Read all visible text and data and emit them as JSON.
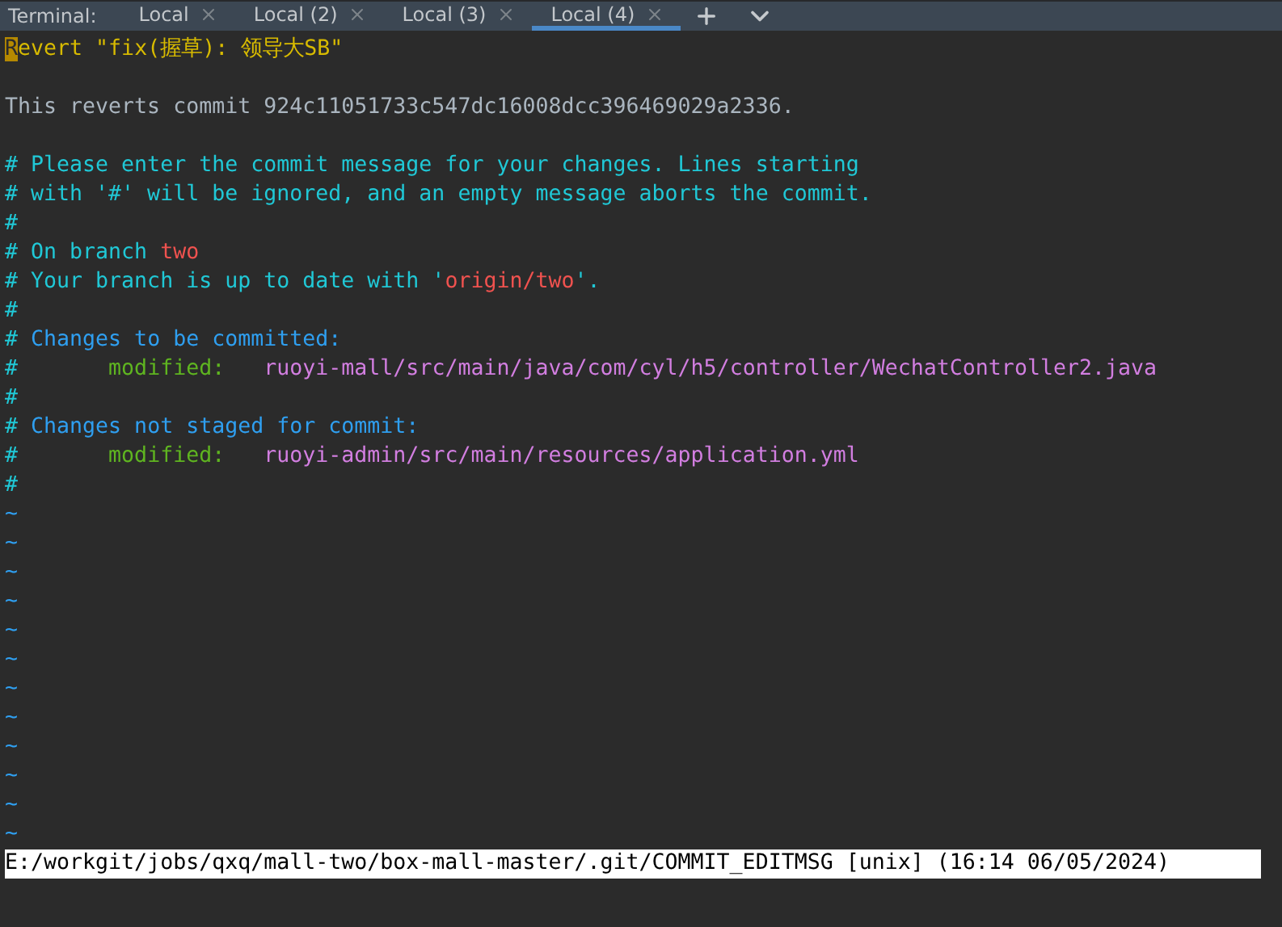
{
  "tab_bar": {
    "label": "Terminal:",
    "tabs": [
      {
        "label": "Local",
        "selected": false
      },
      {
        "label": "Local (2)",
        "selected": false
      },
      {
        "label": "Local (3)",
        "selected": false
      },
      {
        "label": "Local (4)",
        "selected": true
      }
    ]
  },
  "editor": {
    "lines": [
      {
        "kind": "text",
        "segments": [
          {
            "text": "R",
            "kind": "cursor"
          },
          {
            "text": "evert \"fix(握草): 领导大SB\"",
            "kind": "title"
          }
        ]
      },
      {
        "kind": "blank"
      },
      {
        "kind": "text",
        "segments": [
          {
            "text": "This reverts commit 924c11051733c547dc16008dcc396469029a2336.",
            "kind": "plain"
          }
        ]
      },
      {
        "kind": "blank"
      },
      {
        "kind": "text",
        "segments": [
          {
            "text": "# Please enter the commit message for your changes. Lines starting",
            "kind": "comment"
          }
        ]
      },
      {
        "segments": [
          {
            "text": "# with '#' will be ignored, and an empty message aborts the commit.",
            "kind": "comment"
          }
        ]
      },
      {
        "segments": [
          {
            "text": "#",
            "kind": "comment"
          }
        ]
      },
      {
        "segments": [
          {
            "text": "# On branch ",
            "kind": "comment"
          },
          {
            "text": "two",
            "kind": "branch"
          }
        ]
      },
      {
        "segments": [
          {
            "text": "# Your branch is up to date with '",
            "kind": "comment"
          },
          {
            "text": "origin/two",
            "kind": "branch"
          },
          {
            "text": "'.",
            "kind": "comment"
          }
        ]
      },
      {
        "segments": [
          {
            "text": "#",
            "kind": "comment"
          }
        ]
      },
      {
        "segments": [
          {
            "text": "# ",
            "kind": "comment"
          },
          {
            "text": "Changes to be committed:",
            "kind": "section"
          }
        ]
      },
      {
        "segments": [
          {
            "text": "#       ",
            "kind": "comment"
          },
          {
            "text": "modified:",
            "kind": "status"
          },
          {
            "text": "   ruoyi-mall/src/main/java/com/cyl/h5/controller/WechatController2.java",
            "kind": "path"
          }
        ]
      },
      {
        "segments": [
          {
            "text": "#",
            "kind": "comment"
          }
        ]
      },
      {
        "segments": [
          {
            "text": "# ",
            "kind": "comment"
          },
          {
            "text": "Changes not staged for commit:",
            "kind": "section"
          }
        ]
      },
      {
        "segments": [
          {
            "text": "#       ",
            "kind": "comment"
          },
          {
            "text": "modified:",
            "kind": "status"
          },
          {
            "text": "   ruoyi-admin/src/main/resources/application.yml",
            "kind": "path"
          }
        ]
      },
      {
        "segments": [
          {
            "text": "#",
            "kind": "comment"
          }
        ]
      }
    ],
    "empty_lines": [
      "~",
      "~",
      "~",
      "~",
      "~",
      "~",
      "~",
      "~",
      "~",
      "~",
      "~",
      "~"
    ]
  },
  "status_bar": "E:/workgit/jobs/qxq/mall-two/box-mall-master/.git/COMMIT_EDITMSG [unix] (16:14 06/05/2024)"
}
